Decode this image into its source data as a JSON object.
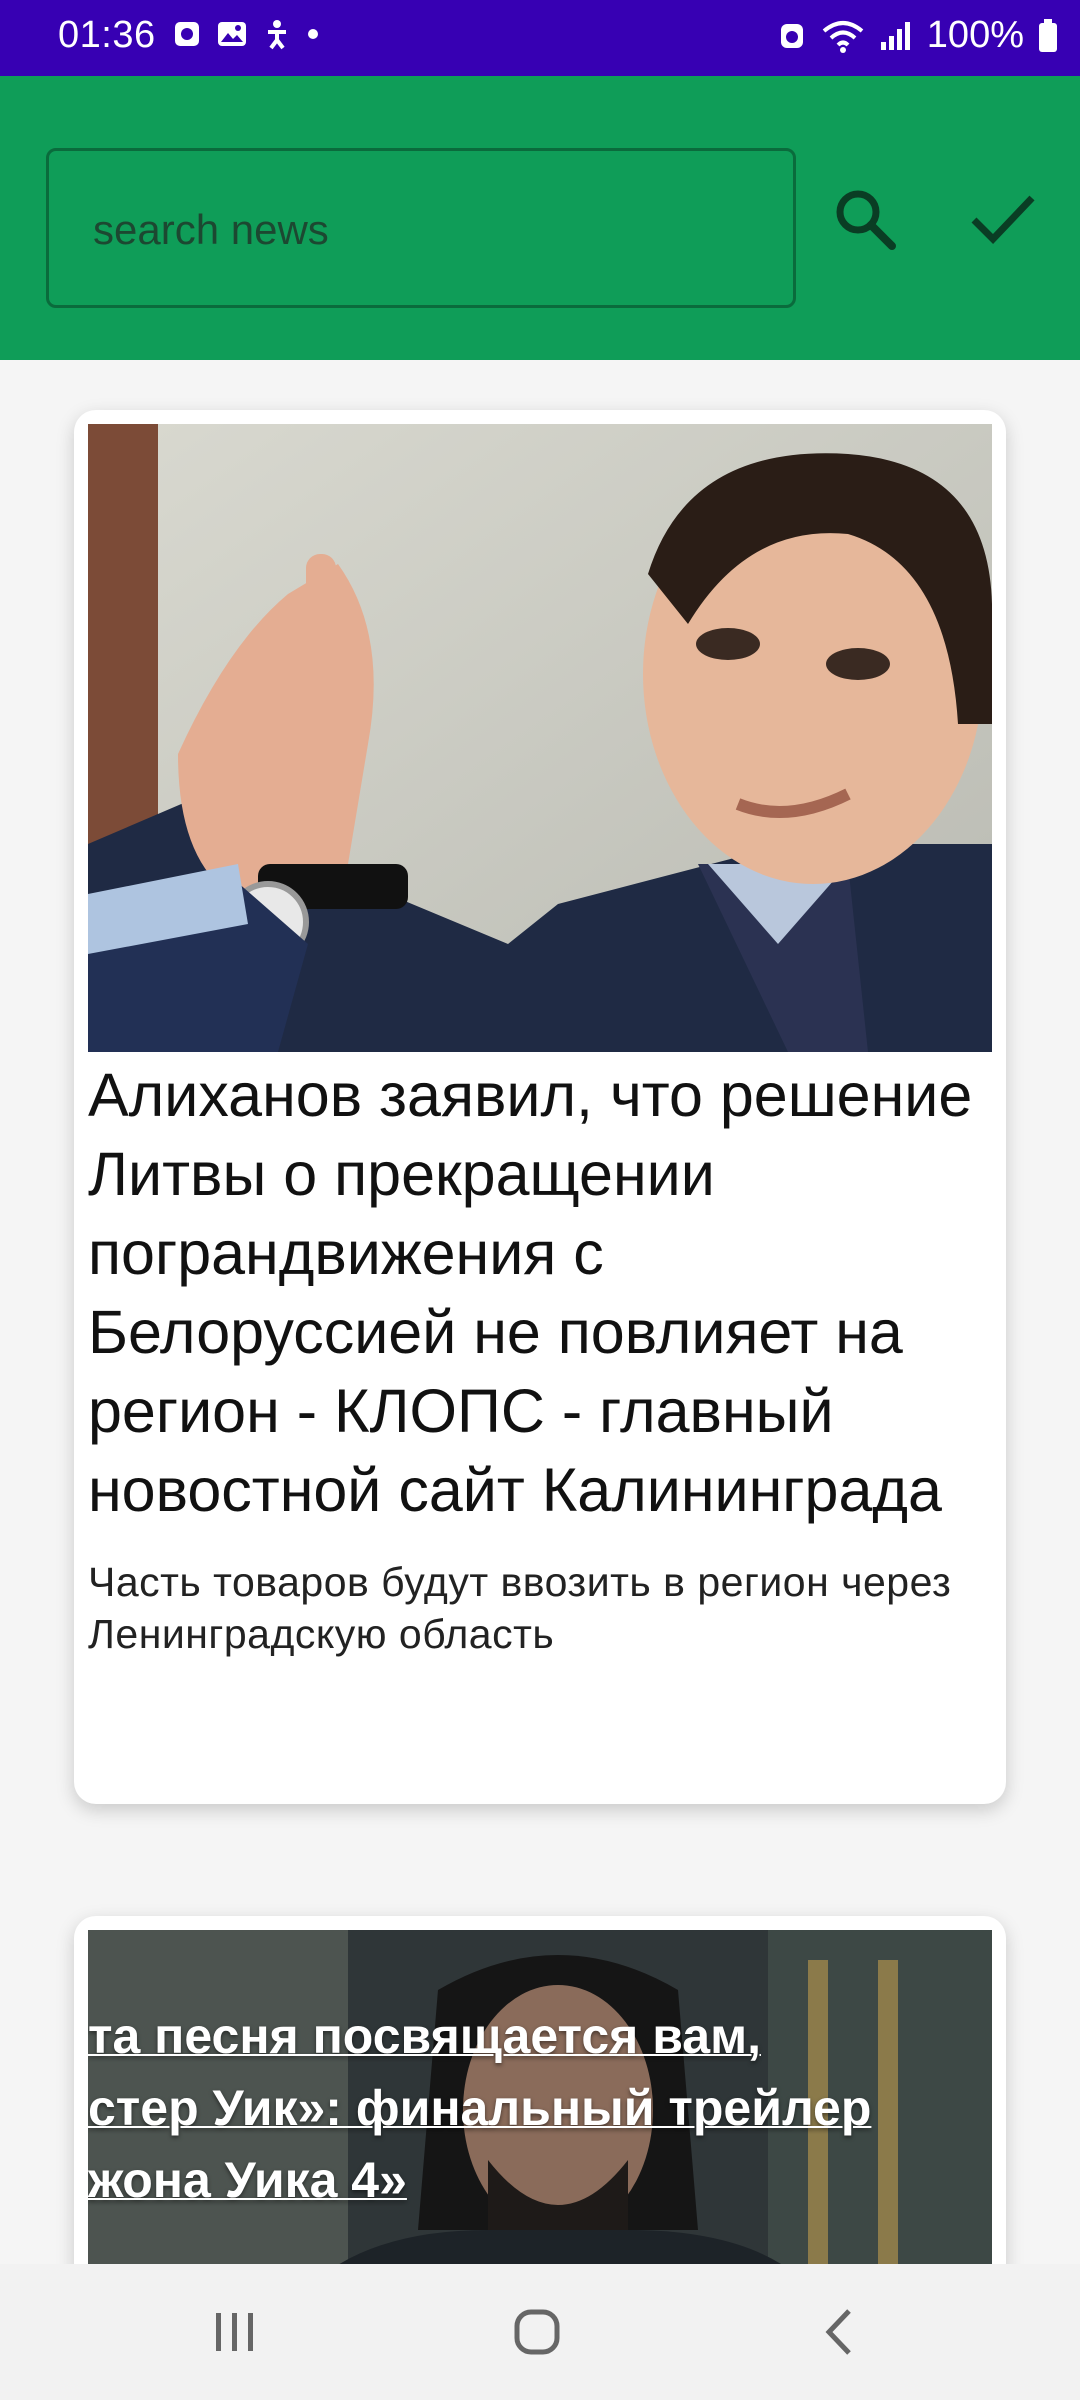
{
  "status_bar": {
    "time": "01:36",
    "battery": "100%"
  },
  "search": {
    "placeholder": "search news"
  },
  "news": [
    {
      "title": "Алиханов заявил, что решение Литвы о прекращении пограндвижения с Белоруссией не повлияет на регион - КЛОПС - главный новостной сайт Калининграда",
      "description": "Часть товаров будут ввозить в регион через Ленинградскую область"
    },
    {
      "title_lines": [
        "та песня посвящается вам,",
        "стер Уик»: финальный трейлер",
        "жона Уика 4»"
      ]
    }
  ],
  "colors": {
    "status_bar": "#3700b3",
    "app_bar": "#0f9d58",
    "icon": "#0a3d24"
  },
  "icons": [
    "search-icon",
    "check-icon",
    "recents-icon",
    "home-icon",
    "back-icon"
  ]
}
